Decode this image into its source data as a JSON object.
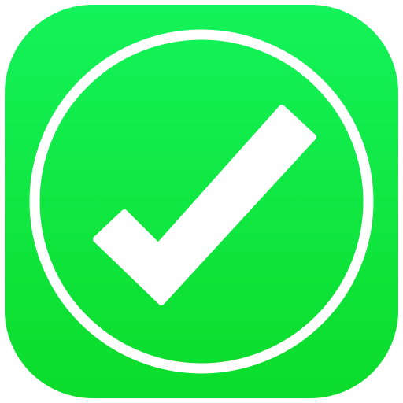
{
  "app_icon": {
    "icon_name": "checkmark-circle-icon",
    "colors": {
      "gradient_top": "#14F35A",
      "gradient_bottom": "#0CDC2A",
      "glyph": "#FFFFFF",
      "background": "#FFFFFF"
    }
  }
}
